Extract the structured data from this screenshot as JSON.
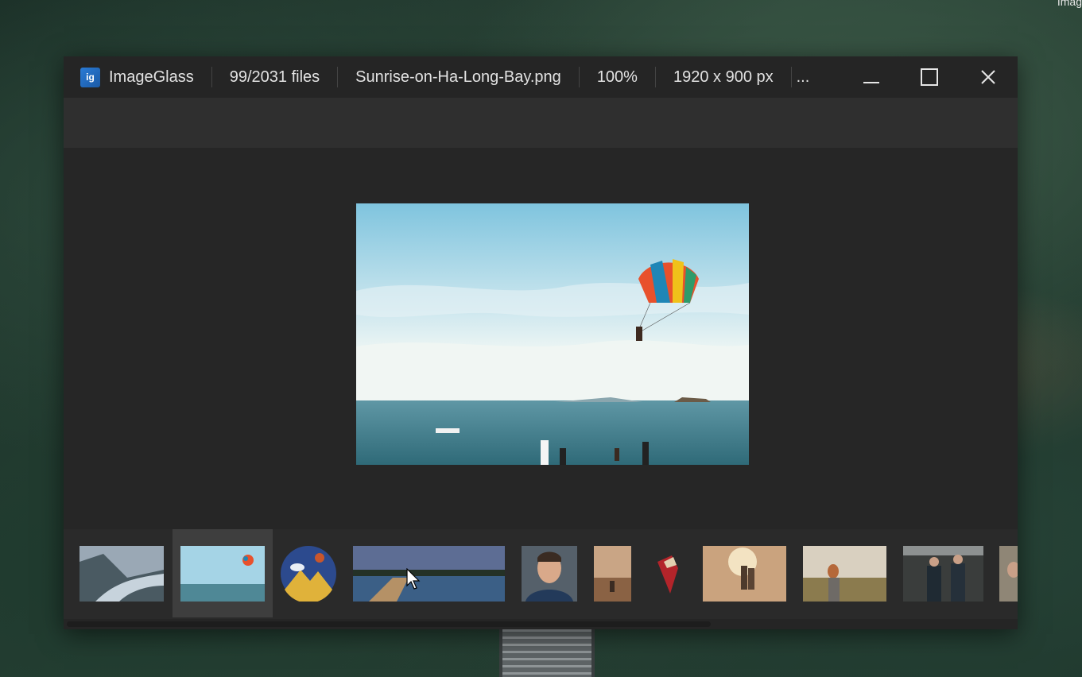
{
  "desktop": {
    "corner_text": "Imag"
  },
  "window": {
    "app_name": "ImageGlass",
    "app_icon_letters": "ig",
    "file_count": "99/2031 files",
    "file_name": "Sunrise-on-Ha-Long-Bay.png",
    "zoom": "100%",
    "dimensions": "1920 x 900 px",
    "more": "...",
    "controls": [
      "minimize-icon",
      "maximize-icon",
      "close-icon"
    ]
  },
  "theme": {
    "title_bg": "#252525",
    "toolbar_bg": "#2f2f2f",
    "viewer_bg": "#262626",
    "thumb_selected_bg": "#3e3e3e",
    "text": "#e2e2e2"
  },
  "thumbnails": [
    {
      "name": "lake-mountains",
      "selected": false
    },
    {
      "name": "parasailing-beach",
      "selected": true
    },
    {
      "name": "imageglass-logo",
      "selected": false
    },
    {
      "name": "pier-panorama",
      "selected": false
    },
    {
      "name": "portrait-man",
      "selected": false
    },
    {
      "name": "desert-person",
      "selected": false
    },
    {
      "name": "red-shape",
      "selected": false
    },
    {
      "name": "couple-sunset",
      "selected": false
    },
    {
      "name": "woman-field",
      "selected": false
    },
    {
      "name": "two-men-street",
      "selected": false
    },
    {
      "name": "partial-portrait",
      "selected": false
    }
  ]
}
